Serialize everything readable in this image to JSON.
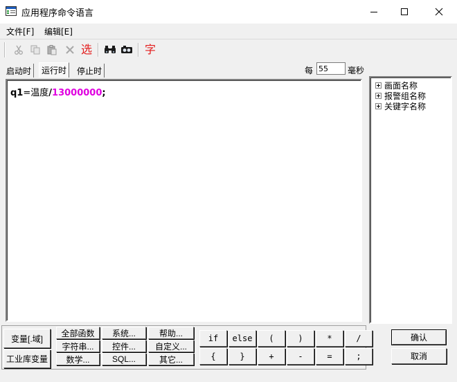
{
  "window": {
    "title": "应用程序命令语言"
  },
  "menu": {
    "items": [
      {
        "label": "文件[F]"
      },
      {
        "label": "编辑[E]"
      }
    ]
  },
  "toolbar": {
    "select_label": "选",
    "font_label": "字",
    "icons": [
      "cut-icon",
      "copy-icon",
      "paste-icon",
      "delete-icon",
      "find-icon",
      "replace-icon"
    ]
  },
  "tabs": [
    {
      "label": "启动时",
      "active": false
    },
    {
      "label": "运行时",
      "active": true
    },
    {
      "label": "停止时",
      "active": false
    }
  ],
  "interval": {
    "prefix": "每",
    "value": "55",
    "unit": "毫秒"
  },
  "editor": {
    "code": {
      "variable": "q1",
      "operator": "=",
      "identifier": "温度",
      "divider": "/",
      "number": "13000000",
      "terminator": ";"
    },
    "colors": {
      "number": "#e000e0"
    }
  },
  "tree": {
    "items": [
      {
        "label": "画面名称"
      },
      {
        "label": "报警组名称"
      },
      {
        "label": "关键字名称"
      }
    ]
  },
  "buttons": {
    "variable": "变量[.域]",
    "industrial_lib_variable": "工业库变量",
    "all_functions": "全部函数",
    "system": "系统...",
    "help": "帮助...",
    "string": "字符串...",
    "control": "控件...",
    "custom": "自定义...",
    "math": "数学...",
    "sql": "SQL...",
    "other": "其它...",
    "operators_row1": [
      "if",
      "else",
      "(",
      ")",
      "*",
      "/"
    ],
    "operators_row2": [
      "{",
      "}",
      "+",
      "-",
      "=",
      ";"
    ],
    "confirm": "确认",
    "cancel": "取消"
  }
}
